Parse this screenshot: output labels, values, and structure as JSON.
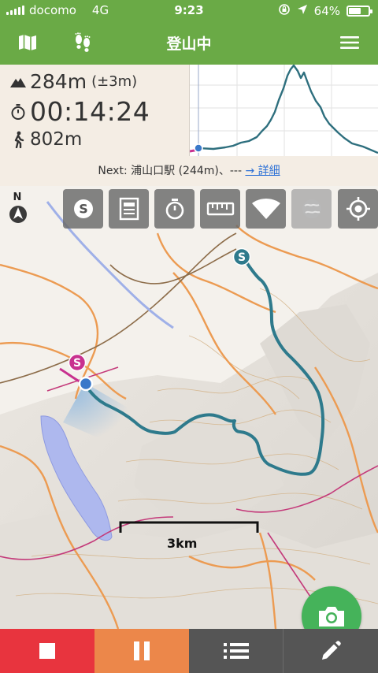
{
  "status_bar": {
    "carrier": "docomo",
    "network": "4G",
    "time": "9:23",
    "battery": "64%",
    "battery_level": 0.64
  },
  "nav": {
    "title": "登山中",
    "left_icons": [
      "map-icon",
      "footprints-icon"
    ],
    "right_icon": "hamburger-menu-icon"
  },
  "stats": {
    "altitude": "284m",
    "altitude_accuracy": "(±3m)",
    "elapsed_time": "00:14:24",
    "distance": "802m",
    "icons": [
      "mountain-icon",
      "stopwatch-icon",
      "walker-icon"
    ]
  },
  "next": {
    "text": "Next: 浦山口駅 (244m)、---",
    "link": "→ 詳細"
  },
  "toolbar": {
    "icons": [
      "start-point-icon",
      "notes-icon",
      "stopwatch-icon",
      "ruler-icon",
      "signal-icon",
      "globe-icon",
      "locate-icon"
    ]
  },
  "map": {
    "scale_label": "3km"
  },
  "bottom_bar": {
    "icons": [
      "stop-icon",
      "pause-icon",
      "list-icon",
      "pencil-icon"
    ]
  },
  "colors": {
    "header": "#6aaa46",
    "route": "#2e7a8c",
    "stop": "#e8343e",
    "pause": "#ec874a",
    "camera": "#45b35a",
    "start_marker": "#c8318f"
  }
}
